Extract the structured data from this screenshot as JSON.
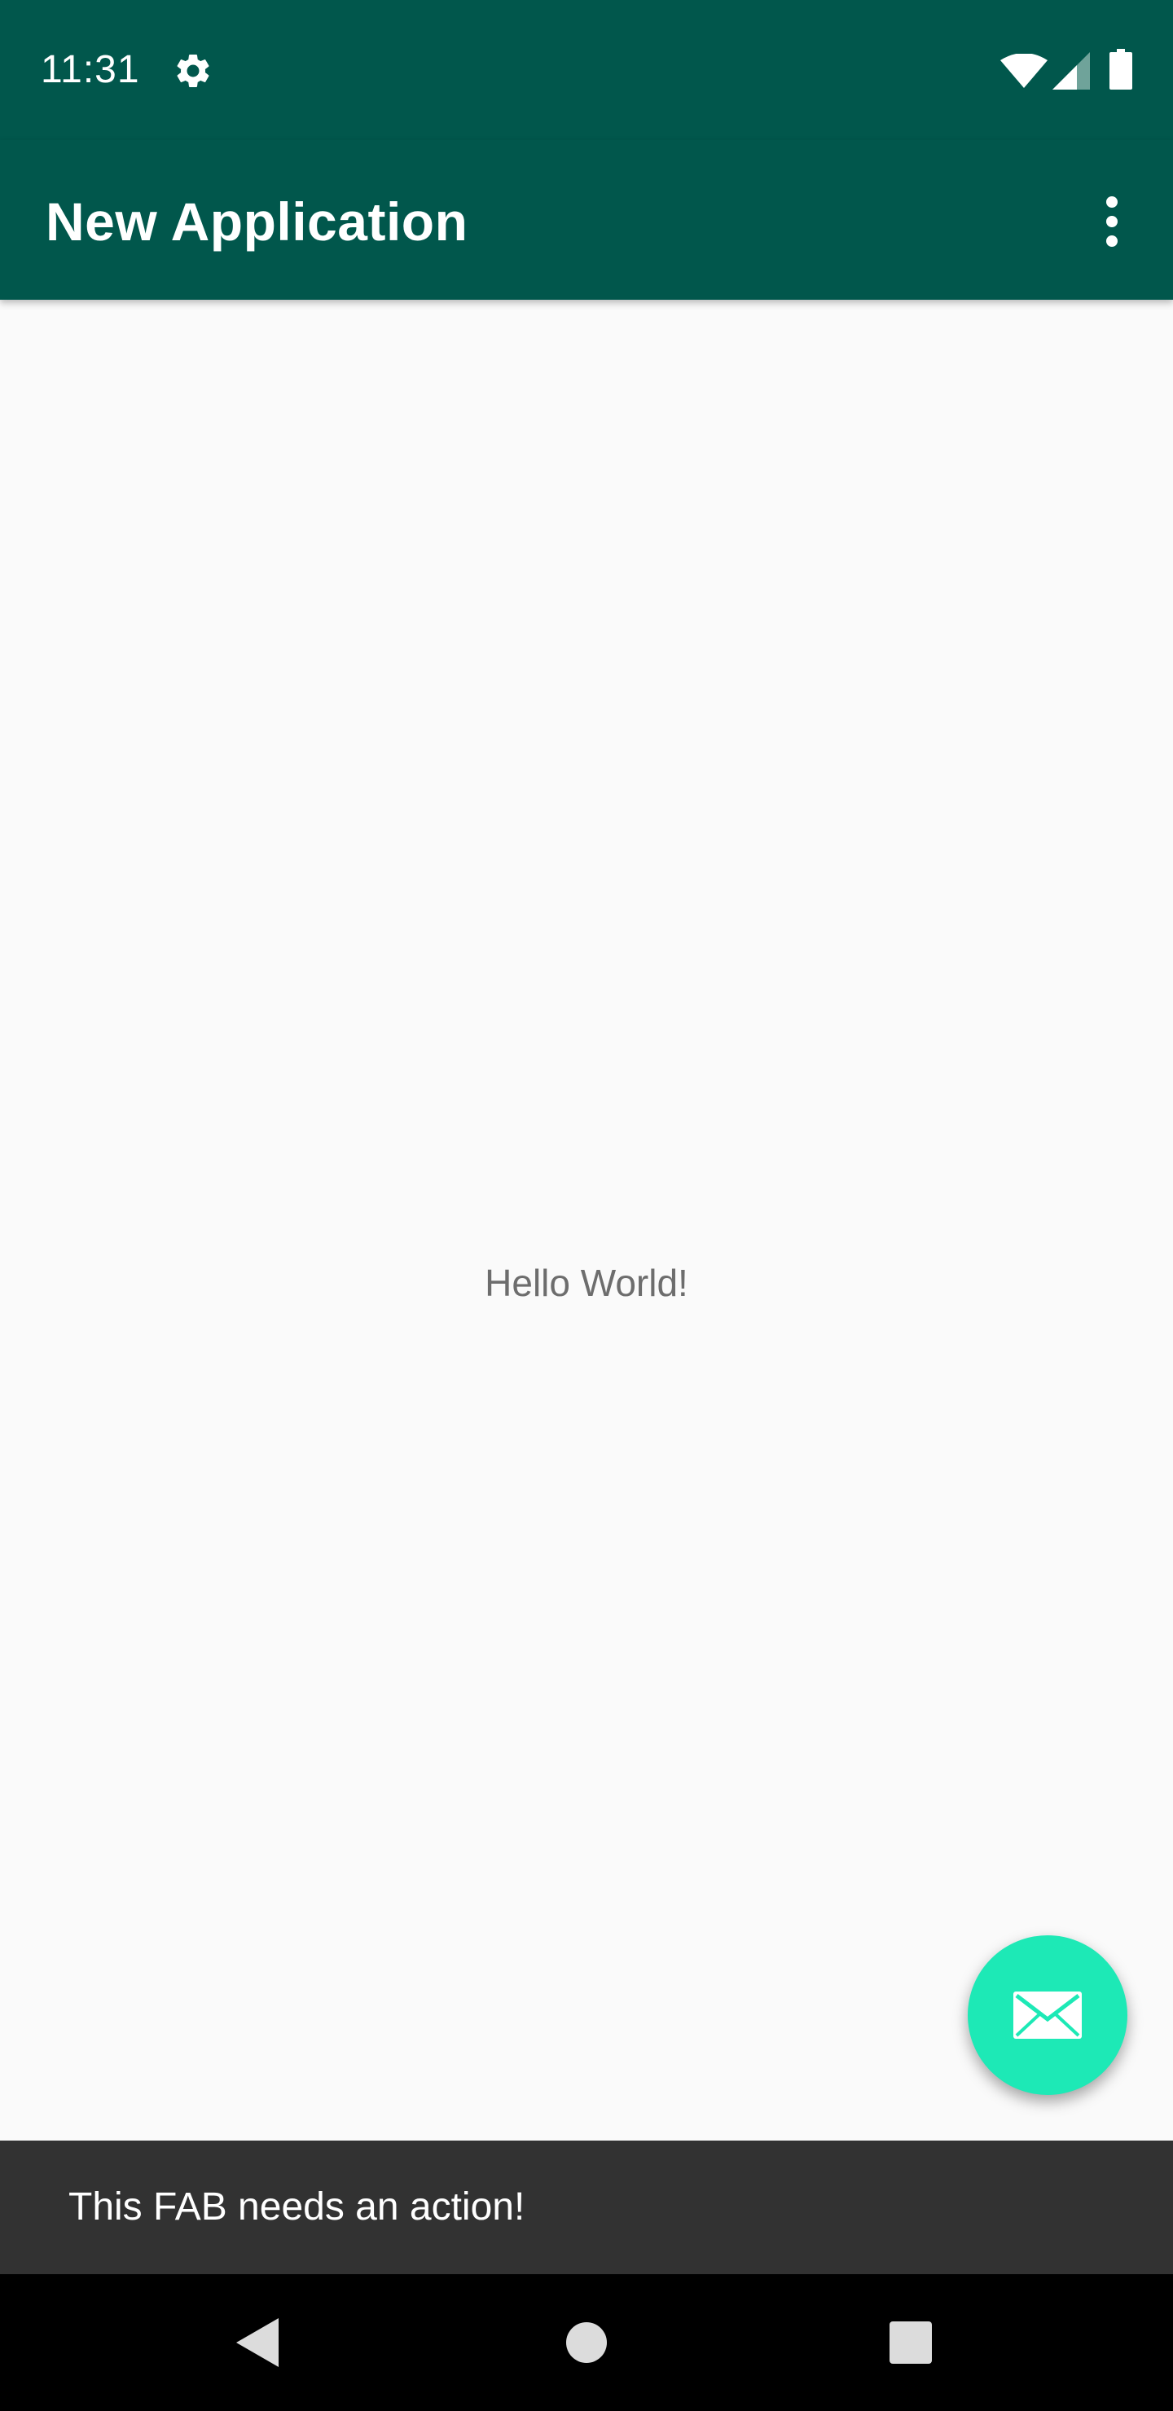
{
  "status_bar": {
    "time": "11:31",
    "icons": [
      "gear-icon",
      "wifi-icon",
      "cell-signal-icon",
      "battery-icon"
    ],
    "background_color": "#01574c"
  },
  "app_bar": {
    "title": "New Application",
    "overflow_icon": "more-vert-icon",
    "background_color": "#01574c"
  },
  "main": {
    "text": "Hello World!",
    "background_color": "#fafafa"
  },
  "fab": {
    "icon": "email-icon",
    "color": "#1de9b6"
  },
  "snackbar": {
    "message": "This FAB needs an action!",
    "background_color": "#323232"
  },
  "nav_bar": {
    "icons": [
      "back-icon",
      "home-icon",
      "recents-icon"
    ]
  }
}
